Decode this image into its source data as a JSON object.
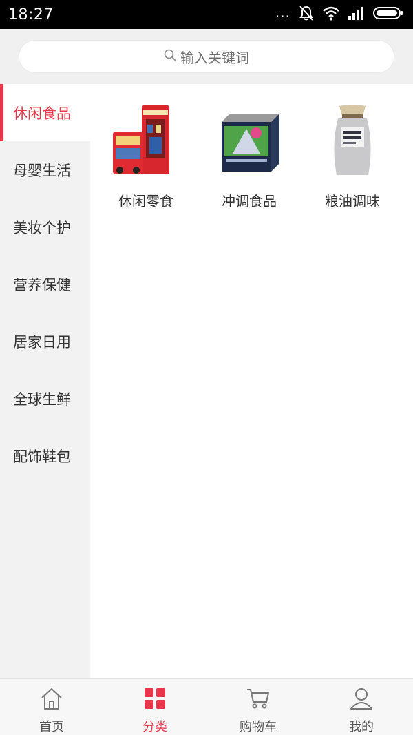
{
  "status_bar": {
    "time": "18:27",
    "overflow": "..."
  },
  "search": {
    "placeholder": "输入关键词"
  },
  "sidebar": {
    "active_index": 0,
    "items": [
      {
        "label": "休闲食品"
      },
      {
        "label": "母婴生活"
      },
      {
        "label": "美妆个护"
      },
      {
        "label": "营养保健"
      },
      {
        "label": "居家日用"
      },
      {
        "label": "全球生鲜"
      },
      {
        "label": "配饰鞋包"
      }
    ]
  },
  "categories": [
    {
      "label": "休闲零食",
      "image": "red-tin-boxes-image"
    },
    {
      "label": "冲调食品",
      "image": "tea-box-image"
    },
    {
      "label": "粮油调味",
      "image": "salt-bag-image"
    }
  ],
  "tabbar": {
    "active_index": 1,
    "items": [
      {
        "label": "首页",
        "icon": "home-icon"
      },
      {
        "label": "分类",
        "icon": "category-grid-icon"
      },
      {
        "label": "购物车",
        "icon": "cart-icon"
      },
      {
        "label": "我的",
        "icon": "profile-icon"
      }
    ]
  },
  "colors": {
    "accent": "#e8374a",
    "sidebar_bg": "#f2f2f2",
    "search_bg": "#f0f0f0"
  }
}
